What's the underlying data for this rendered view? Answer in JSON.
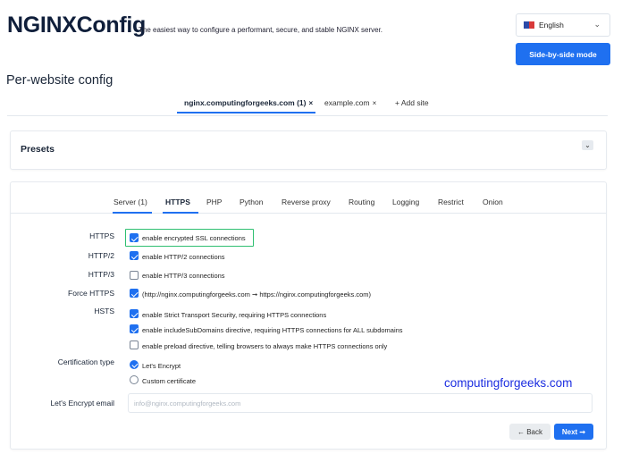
{
  "header": {
    "logo": "NGINXConfig",
    "tagline": "The easiest way to configure a performant, secure, and stable NGINX server.",
    "language": "English",
    "language_icon": "flag-icon",
    "side_by_side_label": "Side-by-side mode"
  },
  "page_title": "Per-website config",
  "site_tabs": [
    {
      "label": "nginx.computingforgeeks.com (1)",
      "close": "×",
      "active": true
    },
    {
      "label": "example.com",
      "close": "×",
      "active": false
    },
    {
      "label": "+ Add site",
      "active": false
    }
  ],
  "presets": {
    "label": "Presets",
    "toggle_icon": "chevron-down-icon"
  },
  "config_tabs": [
    "Server (1)",
    "HTTPS",
    "PHP",
    "Python",
    "Reverse proxy",
    "Routing",
    "Logging",
    "Restrict",
    "Onion"
  ],
  "active_config_tab": "HTTPS",
  "https": {
    "https_label": "HTTPS",
    "https_option": "enable encrypted SSL connections",
    "https_checked": true,
    "http2_label": "HTTP/2",
    "http2_option": "enable HTTP/2 connections",
    "http2_checked": true,
    "http3_label": "HTTP/3",
    "http3_option": "enable HTTP/3 connections",
    "http3_checked": false,
    "force_https_label": "Force HTTPS",
    "force_https_option": "(http://nginx.computingforgeeks.com ➞ https://nginx.computingforgeeks.com)",
    "force_https_checked": true,
    "hsts_label": "HSTS",
    "hsts_options": [
      {
        "label": "enable Strict Transport Security, requiring HTTPS connections",
        "checked": true
      },
      {
        "label": "enable includeSubDomains directive, requiring HTTPS connections for ALL subdomains",
        "checked": true
      },
      {
        "label": "enable preload directive, telling browsers to always make HTTPS connections only",
        "checked": false
      }
    ],
    "cert_type_label": "Certification type",
    "cert_options": [
      {
        "label": "Let's Encrypt",
        "checked": true
      },
      {
        "label": "Custom certificate",
        "checked": false
      }
    ],
    "email_label": "Let's Encrypt email",
    "email_placeholder": "info@nginx.computingforgeeks.com"
  },
  "watermark": "computingforgeeks.com",
  "nav": {
    "back_label": "← Back",
    "next_label": "Next ➞"
  }
}
